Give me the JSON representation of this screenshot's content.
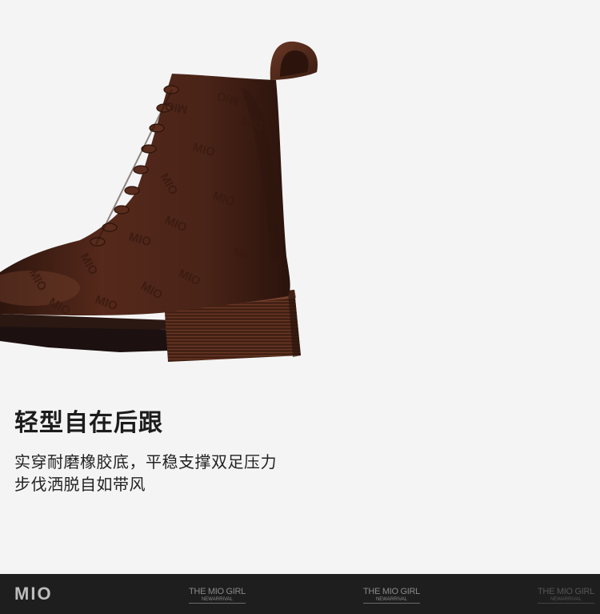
{
  "product": {
    "headline": "轻型自在后跟",
    "description_lines": [
      "实穿耐磨橡胶底，平稳支撑双足压力",
      "步伐洒脱自如带风"
    ],
    "logo_text": "MIO",
    "image_icon": "brown-leather-lace-up-boot-photo"
  },
  "footer": {
    "brand": "MIO",
    "tags": [
      {
        "title": "THE MIO GIRL",
        "sub": "NEWARRIVAL"
      },
      {
        "title": "THE MIO GIRL",
        "sub": "NEWARRIVAL"
      },
      {
        "title": "THE MIO GIRL",
        "sub": "NEWARRIVAL"
      }
    ]
  },
  "colors": {
    "background": "#f4f4f4",
    "leather": "#4a2519",
    "footer_bg": "#1e1e1e",
    "heading_text": "#1c1c1c"
  }
}
